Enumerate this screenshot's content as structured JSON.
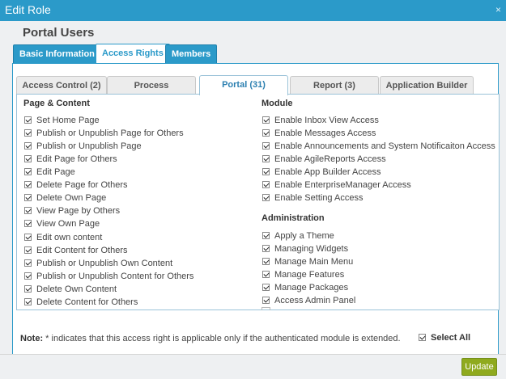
{
  "window": {
    "title": "Edit Role",
    "close_glyph": "×"
  },
  "role": {
    "name": "Portal Users"
  },
  "main_tabs": [
    {
      "label": "Basic Information"
    },
    {
      "label": "Access Rights"
    },
    {
      "label": "Members"
    }
  ],
  "sub_tabs": [
    {
      "label": "Access Control (2)"
    },
    {
      "label": "Process"
    },
    {
      "label": "Portal (31)"
    },
    {
      "label": "Report (3)"
    },
    {
      "label": "Application Builder"
    }
  ],
  "sections": {
    "page_content": {
      "title": "Page & Content",
      "items": [
        "Set Home Page",
        "Publish or Unpublish Page for Others",
        "Publish or Unpublish Page",
        "Edit Page for Others",
        "Edit Page",
        "Delete Page for Others",
        "Delete Own Page",
        "View Page by Others",
        "View Own Page",
        "Edit own content",
        "Edit Content for Others",
        "Publish or Unpublish Own Content",
        "Publish or Unpublish Content for Others",
        "Delete Own Content",
        "Delete Content for Others"
      ]
    },
    "module": {
      "title": "Module",
      "items": [
        "Enable Inbox View Access",
        "Enable Messages Access",
        "Enable Announcements and System Notificaiton Access",
        "Enable AgileReports Access",
        "Enable App Builder Access",
        "Enable EnterpriseManager Access",
        "Enable Setting Access"
      ]
    },
    "administration": {
      "title": "Administration",
      "items": [
        "Apply a Theme",
        "Managing Widgets",
        "Manage Main Menu",
        "Manage Features",
        "Manage Packages",
        "Access Admin Panel"
      ]
    }
  },
  "footer": {
    "note_label": "Note:",
    "note_text": " * indicates that this access right is applicable only if the authenticated module is extended.",
    "select_all_label": "Select All",
    "update_label": "Update"
  },
  "colors": {
    "accent": "#2b9ac9",
    "update_button": "#8faa1e"
  }
}
